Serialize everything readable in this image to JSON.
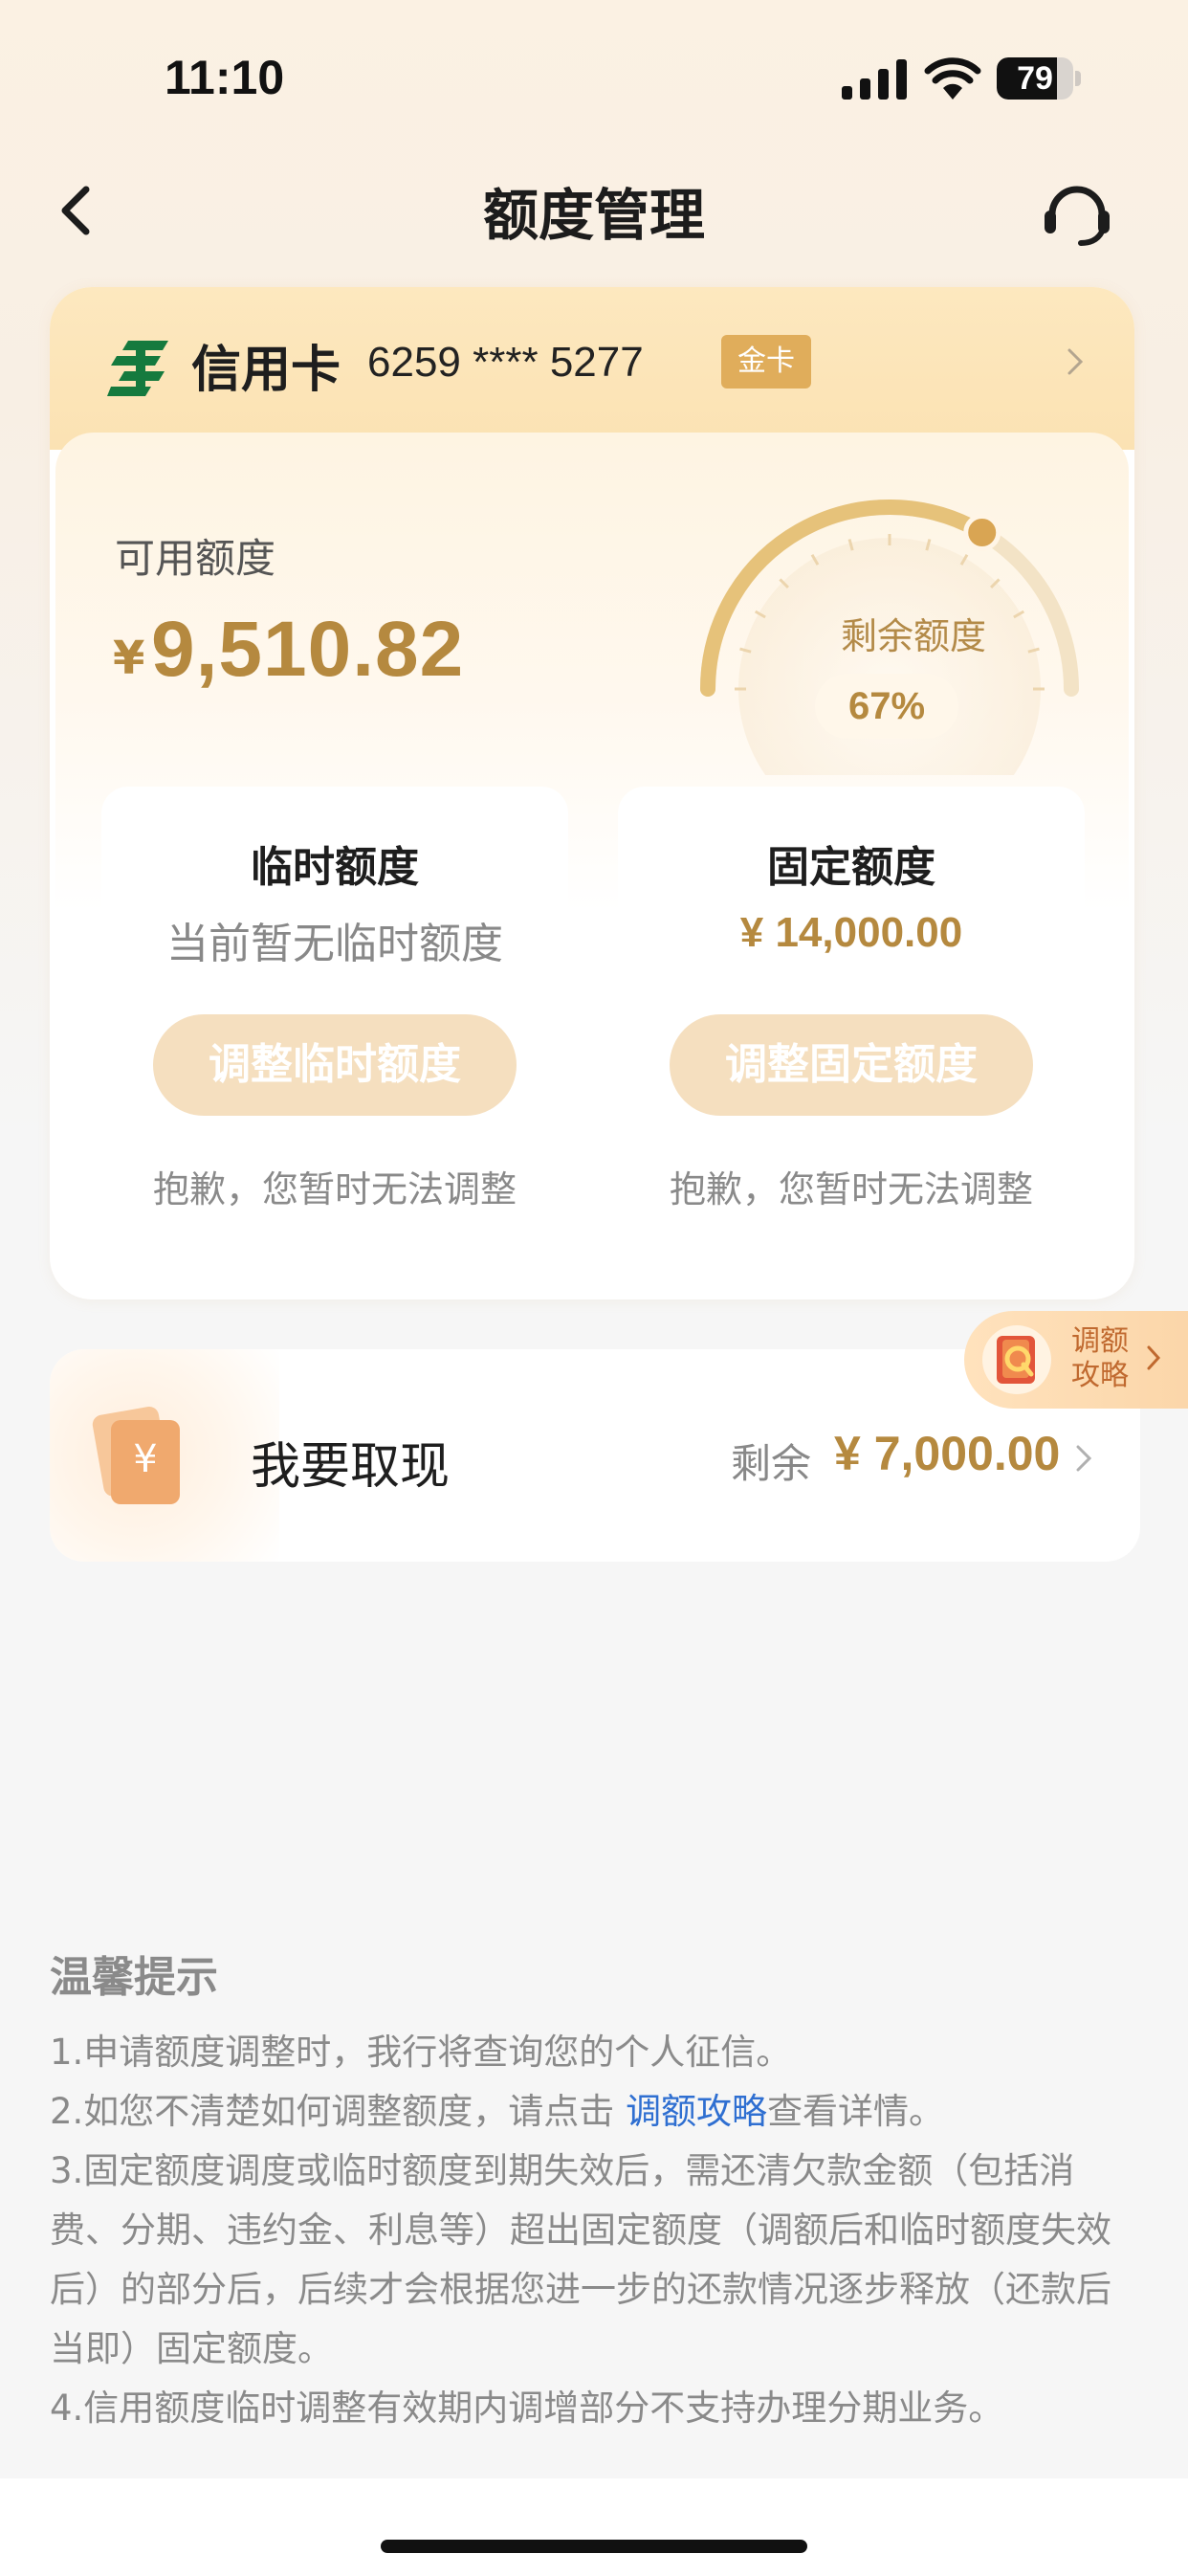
{
  "status_bar": {
    "time": "11:10",
    "battery": "79",
    "battery_level": 0.79
  },
  "nav": {
    "title": "额度管理",
    "back_icon": "chevron-left-icon",
    "service_icon": "headset-icon"
  },
  "card": {
    "type": "信用卡",
    "number": "6259 **** 5277",
    "badge": "金卡",
    "available": {
      "label": "可用额度",
      "currency": "¥",
      "amount": "9,510.82"
    },
    "gauge": {
      "label": "剩余额度",
      "percent_text": "67%",
      "percent_value": 67
    },
    "temporary": {
      "title": "临时额度",
      "subtitle": "当前暂无临时额度",
      "button": "调整临时额度",
      "note": "抱歉，您暂时无法调整"
    },
    "fixed": {
      "title": "固定额度",
      "amount": "¥ 14,000.00",
      "button": "调整固定额度",
      "note": "抱歉，您暂时无法调整"
    }
  },
  "guide_tag": {
    "line1": "调额",
    "line2": "攻略"
  },
  "cash": {
    "label": "我要取现",
    "remaining_label": "剩余",
    "amount": "¥ 7,000.00"
  },
  "tips": {
    "title": "温馨提示",
    "item1": "1.申请额度调整时，我行将查询您的个人征信。",
    "item2_prefix": "2.如您不清楚如何调整额度，请点击 ",
    "item2_link": "调额攻略",
    "item2_suffix": "查看详情。",
    "item3": "3.固定额度调度或临时额度到期失效后，需还清欠款金额（包括消费、分期、违约金、利息等）超出固定额度（调额后和临时额度失效后）的部分后，后续才会根据您进一步的还款情况逐步释放（还款后当即）固定额度。",
    "item4": "4.信用额度临时调整有效期内调增部分不支持办理分期业务。"
  },
  "colors": {
    "gold": "#b5893f",
    "badge": "#e0ad5b",
    "link": "#2f6fd1",
    "button_disabled": "#f5dfbf"
  }
}
